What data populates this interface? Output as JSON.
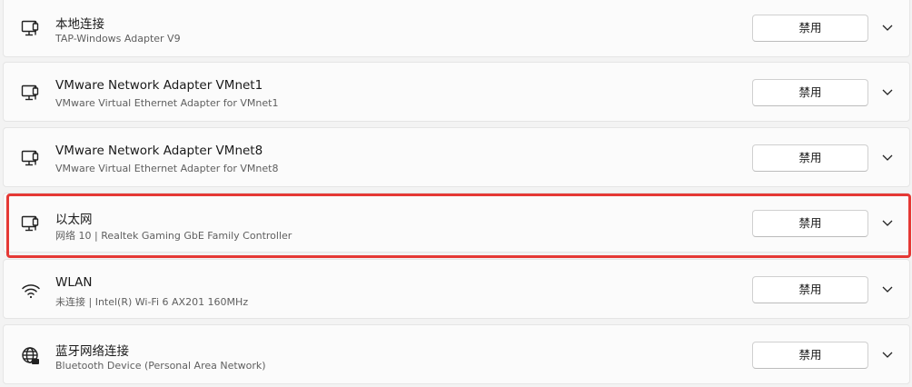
{
  "adapters": [
    {
      "name": "本地连接",
      "description": "TAP-Windows Adapter V9",
      "button": "禁用",
      "icon": "ethernet-icon"
    },
    {
      "name": "VMware Network Adapter VMnet1",
      "description": "VMware Virtual Ethernet Adapter for VMnet1",
      "button": "禁用",
      "icon": "ethernet-icon"
    },
    {
      "name": "VMware Network Adapter VMnet8",
      "description": "VMware Virtual Ethernet Adapter for VMnet8",
      "button": "禁用",
      "icon": "ethernet-icon"
    },
    {
      "name": "以太网",
      "description": "网络 10 | Realtek Gaming GbE Family Controller",
      "button": "禁用",
      "icon": "ethernet-icon"
    },
    {
      "name": "WLAN",
      "description": "未连接 | Intel(R) Wi-Fi 6 AX201 160MHz",
      "button": "禁用",
      "icon": "wifi-icon"
    },
    {
      "name": "蓝牙网络连接",
      "description": "Bluetooth Device (Personal Area Network)",
      "button": "禁用",
      "icon": "globe-icon"
    }
  ],
  "colors": {
    "highlight": "#e53935",
    "row_background": "#fbfbfb",
    "page_background": "#f3f3f3"
  }
}
